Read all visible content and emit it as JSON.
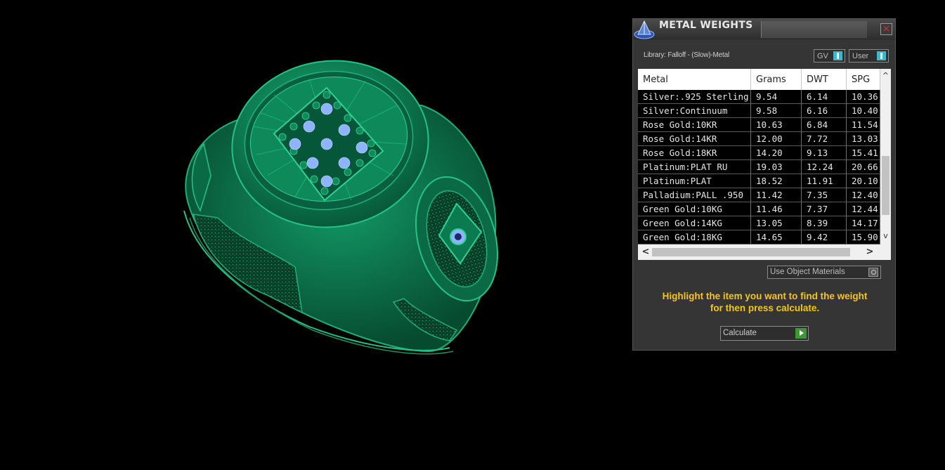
{
  "window": {
    "title": "METAL WEIGHTS",
    "close_glyph": "×"
  },
  "library": {
    "label": "Library: Falloff - (Slow)-Metal"
  },
  "toggles": {
    "gv": "GV",
    "user": "User"
  },
  "table": {
    "columns": [
      "Metal",
      "Grams",
      "DWT",
      "SPG"
    ],
    "rows": [
      [
        "Silver:.925 Sterling",
        "9.54",
        "6.14",
        "10.36"
      ],
      [
        "Silver:Continuum",
        "9.58",
        "6.16",
        "10.40"
      ],
      [
        "Rose Gold:10KR",
        "10.63",
        "6.84",
        "11.54"
      ],
      [
        "Rose Gold:14KR",
        "12.00",
        "7.72",
        "13.03"
      ],
      [
        "Rose Gold:18KR",
        "14.20",
        "9.13",
        "15.41"
      ],
      [
        "Platinum:PLAT RU",
        "19.03",
        "12.24",
        "20.66"
      ],
      [
        "Platinum:PLAT",
        "18.52",
        "11.91",
        "20.10"
      ],
      [
        "Palladium:PALL .950",
        "11.42",
        "7.35",
        "12.40"
      ],
      [
        "Green Gold:10KG",
        "11.46",
        "7.37",
        "12.44"
      ],
      [
        "Green Gold:14KG",
        "13.05",
        "8.39",
        "14.17"
      ],
      [
        "Green Gold:18KG",
        "14.65",
        "9.42",
        "15.90"
      ]
    ],
    "scroll_glyphs": {
      "up": "^",
      "down": "v",
      "left": "<",
      "right": ">"
    }
  },
  "use_object_materials": {
    "label": "Use Object Materials"
  },
  "hint": {
    "line1": "Highlight the item you want to find the weight",
    "line2": "for then press calculate."
  },
  "calculate": {
    "label": "Calculate"
  },
  "colors": {
    "ring_green": "#0f7a52",
    "gem_blue": "#8fb4ff",
    "hint_yellow": "#f5c518",
    "toggle_cyan": "#3fb7c9",
    "go_green": "#3a9a2f"
  }
}
